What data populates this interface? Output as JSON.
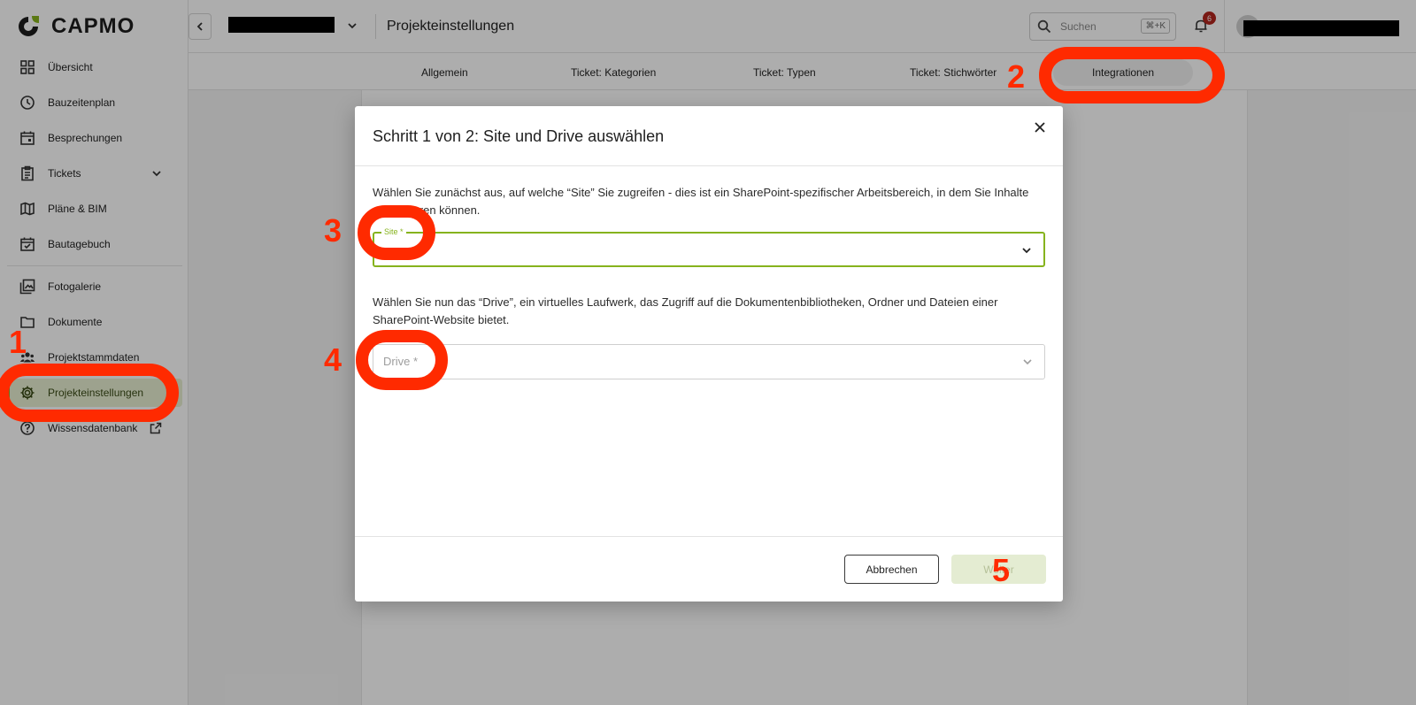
{
  "app": {
    "logo_text": "CAPMO"
  },
  "sidebar": {
    "items": [
      {
        "label": "Übersicht",
        "icon": "grid-icon"
      },
      {
        "label": "Bauzeitenplan",
        "icon": "clock-icon"
      },
      {
        "label": "Besprechungen",
        "icon": "calendar-icon"
      },
      {
        "label": "Tickets",
        "icon": "clipboard-icon"
      },
      {
        "label": "Pläne & BIM",
        "icon": "map-icon"
      },
      {
        "label": "Bautagebuch",
        "icon": "calendar-check-icon"
      },
      {
        "label": "Fotogalerie",
        "icon": "image-icon"
      },
      {
        "label": "Dokumente",
        "icon": "folder-icon"
      },
      {
        "label": "Projektstammdaten",
        "icon": "people-icon"
      },
      {
        "label": "Projekteinstellungen",
        "icon": "gear-icon"
      },
      {
        "label": "Wissensdatenbank",
        "icon": "help-icon"
      }
    ]
  },
  "header": {
    "page_title": "Projekteinstellungen",
    "search_placeholder": "Suchen",
    "search_shortcut": "⌘+K",
    "notification_count": "6"
  },
  "tabs": [
    {
      "label": "Allgemein"
    },
    {
      "label": "Ticket: Kategorien"
    },
    {
      "label": "Ticket: Typen"
    },
    {
      "label": "Ticket: Stichwörter"
    },
    {
      "label": "Integrationen"
    }
  ],
  "modal": {
    "title": "Schritt 1 von 2: Site und Drive auswählen",
    "site_text": "Wählen Sie zunächst aus, auf welche “Site” Sie zugreifen - dies ist ein SharePoint-spezifischer Arbeitsbereich, in dem Sie Inhalte organisieren können.",
    "site_label": "Site *",
    "drive_text": "Wählen Sie nun das “Drive”, ein virtuelles Laufwerk, das Zugriff auf die Dokumentenbibliotheken, Ordner und Dateien einer SharePoint-Website bietet.",
    "drive_placeholder": "Drive *",
    "cancel_label": "Abbrechen",
    "next_label": "Weiter"
  },
  "annotations": [
    "1",
    "2",
    "3",
    "4",
    "5"
  ],
  "colors": {
    "accent": "#86b31d",
    "annotation": "#ff2a00",
    "badge": "#b3261e"
  }
}
